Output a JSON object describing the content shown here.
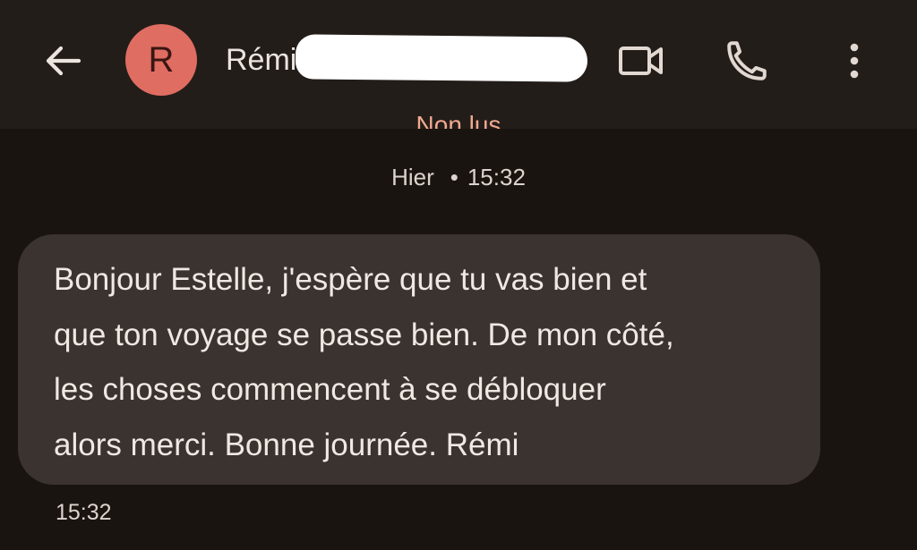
{
  "header": {
    "back_icon": "arrow-left-icon",
    "avatar_initial": "R",
    "avatar_color": "#e06d62",
    "contact_name": "Rémi",
    "video_icon": "video-call-icon",
    "phone_icon": "phone-icon",
    "more_icon": "more-vert-icon"
  },
  "conversation": {
    "partial_label": "Non lus",
    "day_label": "Hier",
    "separator": "•",
    "time_label": "15:32"
  },
  "messages": [
    {
      "lines": [
        "Bonjour Estelle, j'espère que tu vas bien et",
        "que ton voyage se passe bien. De mon côté,",
        "les choses commencent à se débloquer",
        "alors merci. Bonne journée. Rémi"
      ],
      "time": "15:32"
    }
  ],
  "colors": {
    "background": "#1a1411",
    "header_background": "#231d1a",
    "bubble_background": "#3a3330",
    "accent_unread": "#f1a98f"
  }
}
